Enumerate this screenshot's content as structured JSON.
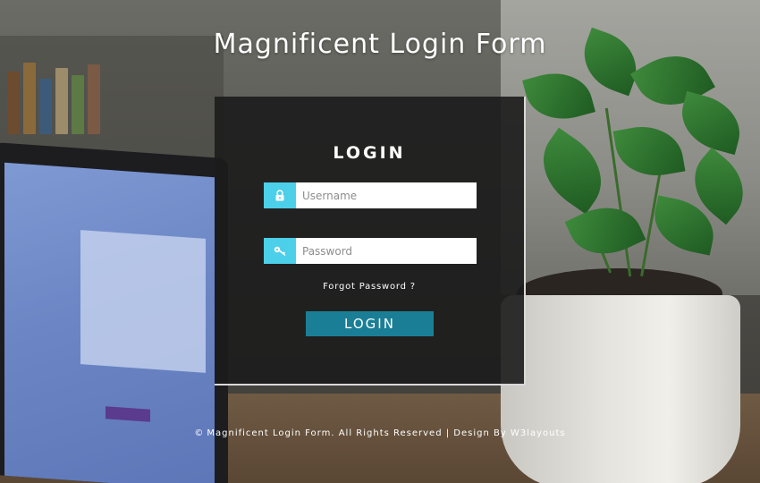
{
  "page": {
    "title": "Magnificent Login Form"
  },
  "login": {
    "heading": "LOGIN",
    "username": {
      "placeholder": "Username",
      "icon": "user-icon"
    },
    "password": {
      "placeholder": "Password",
      "icon": "key-icon"
    },
    "forgot_label": "Forgot Password ?",
    "submit_label": "LOGIN"
  },
  "footer": {
    "copyright_symbol": "©",
    "text": "Magnificent Login Form. All Rights Reserved | Design By W3layouts"
  },
  "colors": {
    "accent": "#4ccfe8",
    "button": "#1a7f96",
    "panel": "#1c1c1c"
  }
}
